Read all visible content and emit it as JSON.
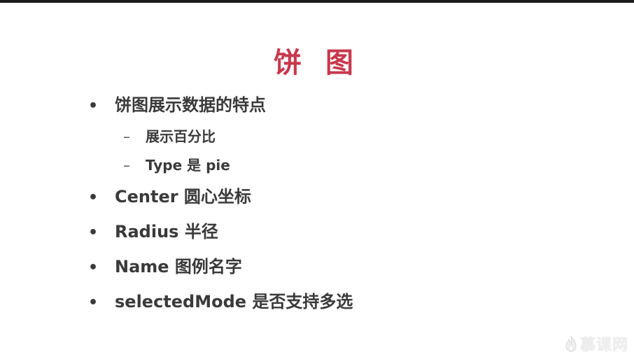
{
  "slide": {
    "title": "饼 图",
    "bullets": [
      {
        "text": "饼图展示数据的特点",
        "sub": [
          "展示百分比",
          "Type 是 pie"
        ]
      },
      {
        "text": "Center 圆心坐标"
      },
      {
        "text": "Radius 半径"
      },
      {
        "text": "Name 图例名字"
      },
      {
        "text": "selectedMode 是否支持多选"
      }
    ],
    "bullet_symbol": "•",
    "sub_symbol": "–"
  },
  "watermark": {
    "text": "慕课网",
    "icon": "flame-icon",
    "color": "#ededed"
  },
  "colors": {
    "title": "#c8384d",
    "text": "#3a3a3a",
    "top_bar": "#1b1b1b"
  }
}
